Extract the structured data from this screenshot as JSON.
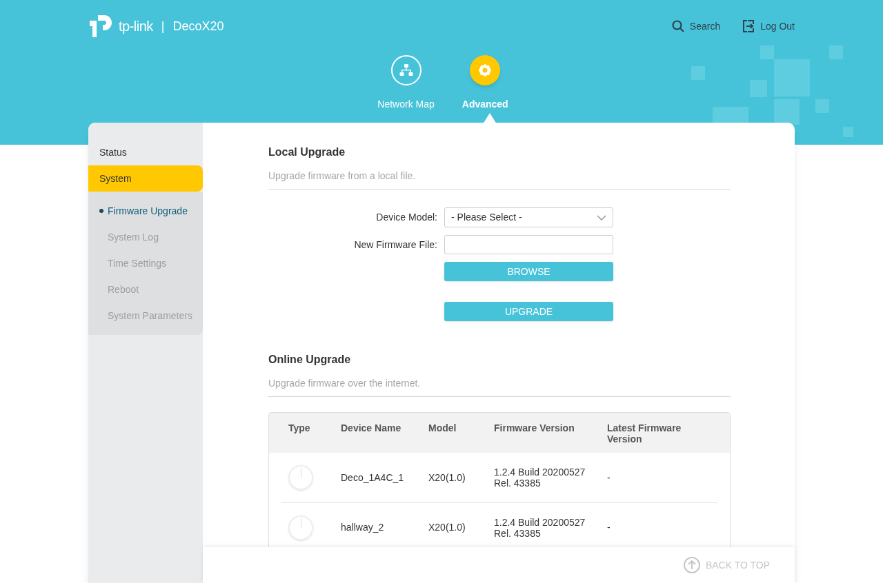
{
  "header": {
    "brand": "tp-link",
    "separator": "|",
    "product": "DecoX20",
    "search": "Search",
    "logout": "Log Out"
  },
  "nav": [
    {
      "label": "Network Map",
      "kind": "network",
      "selected": false
    },
    {
      "label": "Advanced",
      "kind": "gear",
      "selected": true
    }
  ],
  "sidebar": {
    "items": [
      {
        "label": "Status",
        "selected": false
      },
      {
        "label": "System",
        "selected": true,
        "children": [
          {
            "label": "Firmware Upgrade",
            "selected": true
          },
          {
            "label": "System Log",
            "selected": false
          },
          {
            "label": "Time Settings",
            "selected": false
          },
          {
            "label": "Reboot",
            "selected": false
          },
          {
            "label": "System Parameters",
            "selected": false
          }
        ]
      }
    ]
  },
  "local": {
    "title": "Local Upgrade",
    "subtitle": "Upgrade firmware from a local file.",
    "model_label": "Device Model:",
    "model_value": "- Please Select -",
    "file_label": "New Firmware File:",
    "browse": "BROWSE",
    "upgrade": "UPGRADE"
  },
  "online": {
    "title": "Online Upgrade",
    "subtitle": "Upgrade firmware over the internet.",
    "table": {
      "columns": [
        "Type",
        "Device Name",
        "Model",
        "Firmware Version",
        "Latest Firmware Version"
      ],
      "rows": [
        {
          "name": "Deco_1A4C_1",
          "model": "X20(1.0)",
          "firmware": [
            "1.2.4 Build 20200527",
            "Rel. 43385"
          ],
          "latest": "-"
        },
        {
          "name": "hallway_2",
          "model": "X20(1.0)",
          "firmware": [
            "1.2.4 Build 20200527",
            "Rel. 43385"
          ],
          "latest": "-"
        }
      ]
    }
  },
  "back_to_top": "BACK TO TOP"
}
